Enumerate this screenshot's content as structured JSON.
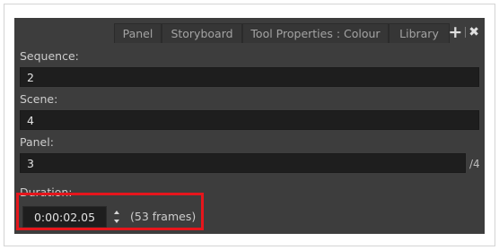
{
  "tabs": [
    {
      "label": "Panel",
      "active": true
    },
    {
      "label": "Storyboard",
      "active": false
    },
    {
      "label": "Tool Properties : Colour",
      "active": false
    },
    {
      "label": "Library",
      "active": false
    }
  ],
  "tab_actions": {
    "add_icon": "plus-icon",
    "close_icon": "close-icon"
  },
  "fields": {
    "sequence": {
      "label": "Sequence:",
      "value": "2"
    },
    "scene": {
      "label": "Scene:",
      "value": "4"
    },
    "panel": {
      "label": "Panel:",
      "value": "3",
      "total": "/4"
    },
    "duration": {
      "label": "Duration:",
      "value": "0:00:02.05",
      "frames": "(53 frames)"
    }
  },
  "colors": {
    "panel_bg": "#3d3d3d",
    "field_bg": "#1e1e1e",
    "highlight": "#e6161c"
  }
}
